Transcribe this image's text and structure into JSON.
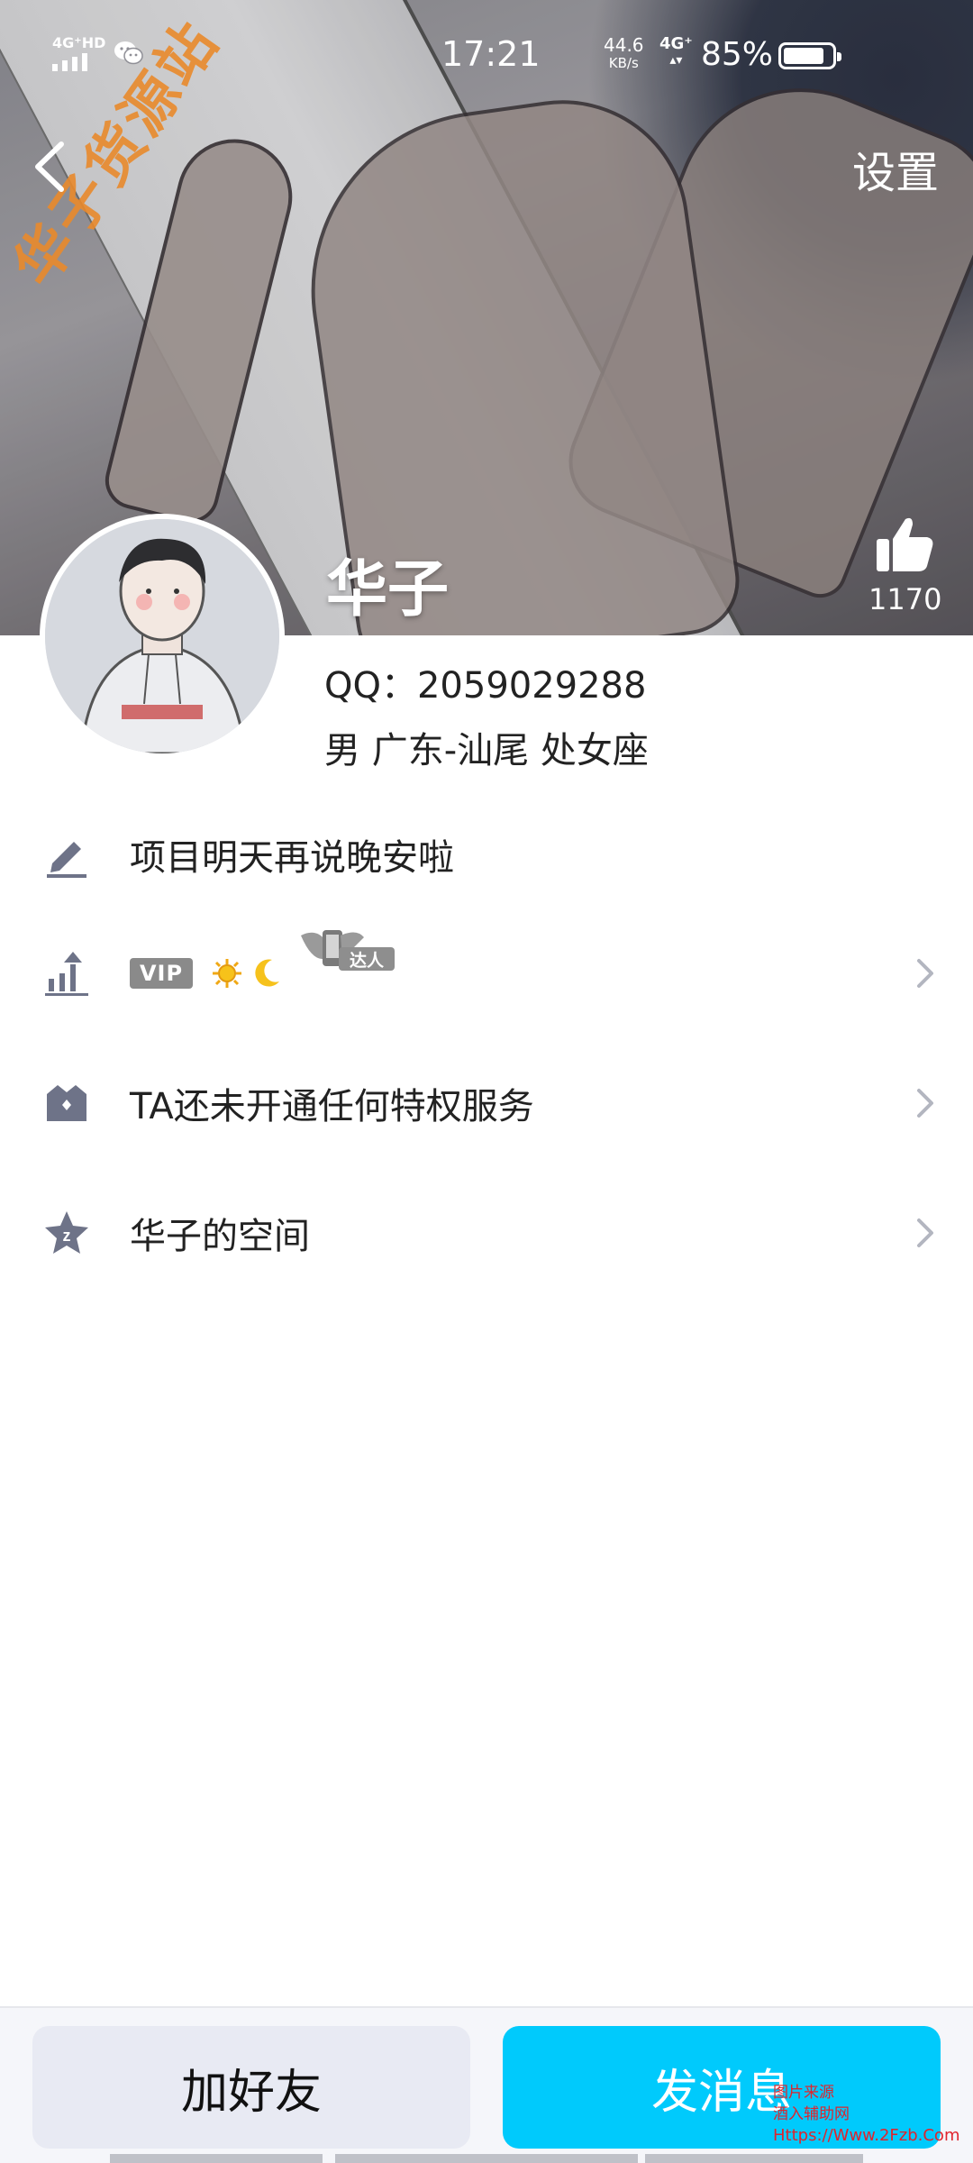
{
  "status_bar": {
    "time": "17:21",
    "signal_label": "4G⁺HD",
    "speed_value": "44.6",
    "speed_unit": "KB/s",
    "network": "4G⁺",
    "battery_percent": "85%",
    "battery_level": 0.85
  },
  "cover": {
    "watermark_text": "华子货源站"
  },
  "nav": {
    "settings_label": "设置"
  },
  "profile": {
    "nickname": "华子",
    "likes": "1170",
    "qq_line": "QQ：2059029288",
    "info_line": "男 广东-汕尾 处女座"
  },
  "rows": {
    "signature": "项目明天再说晚安啦",
    "vip_badge": "VIP",
    "daren_badge": "达人",
    "privilege": "TA还未开通任何特权服务",
    "qzone": "华子的空间"
  },
  "actions": {
    "add_friend": "加好友",
    "send_message": "发消息"
  },
  "watermark": {
    "line1": "图片来源",
    "line2": "酒入辅助网",
    "line3": "Https://Www.2Fzb.Com"
  },
  "colors": {
    "accent": "#00cafc",
    "icon_gray": "#6e7388",
    "button_gray": "#e8eaf3"
  }
}
